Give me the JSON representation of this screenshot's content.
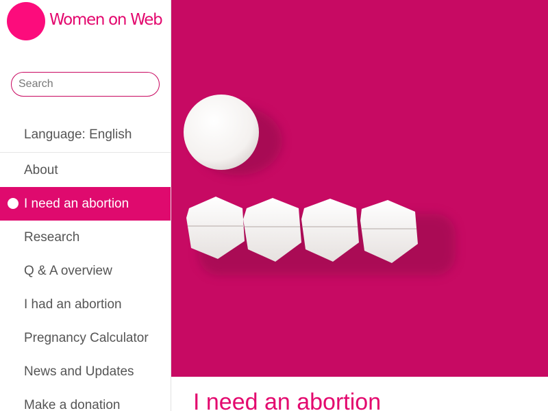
{
  "site": {
    "name": "Women on Web"
  },
  "search": {
    "placeholder": "Search"
  },
  "language": {
    "label": "Language: English"
  },
  "nav": {
    "items": [
      {
        "label": "About"
      },
      {
        "label": "I need an abortion"
      },
      {
        "label": "Research"
      },
      {
        "label": "Q & A overview"
      },
      {
        "label": "I had an abortion"
      },
      {
        "label": "Pregnancy Calculator"
      },
      {
        "label": "News and Updates"
      },
      {
        "label": "Make a donation"
      }
    ],
    "active_index": 1
  },
  "main": {
    "heading": "I need an abortion",
    "hero_image": "pills-on-magenta-background"
  },
  "colors": {
    "brand": "#fc0c7c",
    "brand_text": "#e3086e",
    "active_nav": "#df0a6e",
    "hero_background": "#c70a63"
  }
}
